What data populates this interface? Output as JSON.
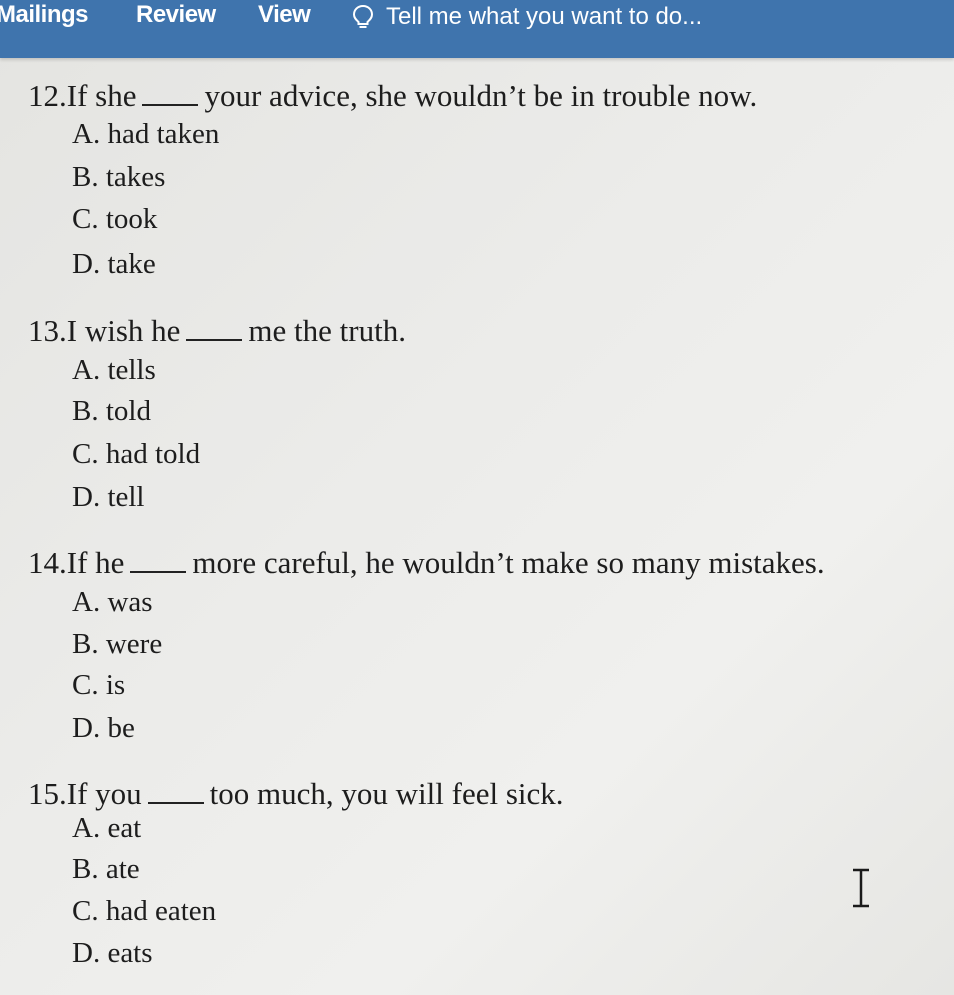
{
  "ribbon": {
    "tabs": [
      "Mailings",
      "Review",
      "View"
    ],
    "tell_me": "Tell me what you want to do...",
    "tell_me_icon": "lightbulb-icon"
  },
  "questions": [
    {
      "number": "12.",
      "before": "If she",
      "after": "your advice, she wouldn’t be in trouble now.",
      "options": [
        "A. had taken",
        "B. takes",
        "C. took",
        "D. take"
      ]
    },
    {
      "number": "13.",
      "before": "I wish he",
      "after": "me the truth.",
      "options": [
        "A. tells",
        "B. told",
        "C. had told",
        "D. tell"
      ]
    },
    {
      "number": "14.",
      "before": "If he",
      "after": "more careful, he wouldn’t make so many mistakes.",
      "options": [
        "A. was",
        "B. were",
        "C. is",
        "D. be"
      ]
    },
    {
      "number": "15.",
      "before": "If you",
      "after": "too much, you will feel sick.",
      "options": [
        "A. eat",
        "B. ate",
        "C. had eaten",
        "D. eats"
      ]
    }
  ],
  "cursor_icon": "text-cursor-icon"
}
